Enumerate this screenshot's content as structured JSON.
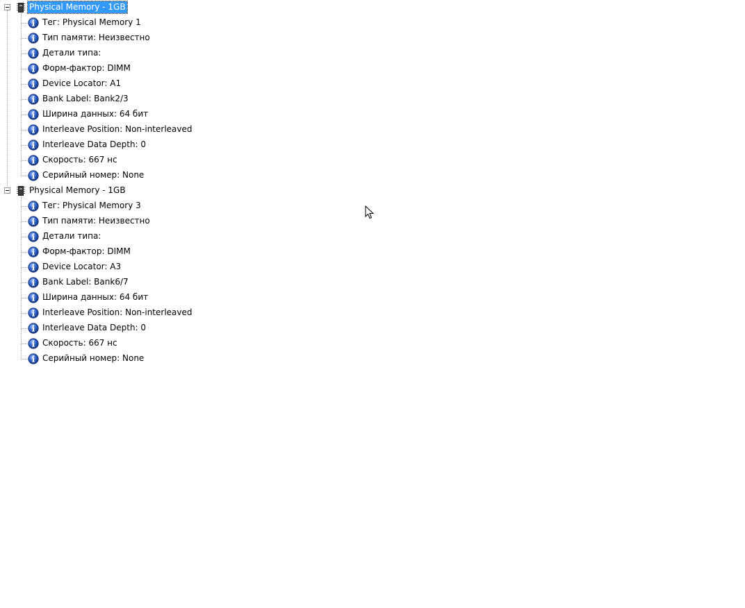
{
  "tree": {
    "nodes": [
      {
        "label": "Physical Memory - 1GB",
        "selected": true,
        "icon": "memory-chip-icon",
        "children": [
          "Тег: Physical Memory 1",
          "Тип памяти: Неизвестно",
          "Детали типа:",
          "Форм-фактор: DIMM",
          "Device Locator: A1",
          "Bank Label: Bank2/3",
          "Ширина данных: 64 бит",
          "Interleave Position: Non-interleaved",
          "Interleave Data Depth: 0",
          "Скорость: 667 нс",
          "Серийный номер: None"
        ]
      },
      {
        "label": "Physical Memory - 1GB",
        "selected": false,
        "icon": "memory-chip-icon",
        "children": [
          "Тег: Physical Memory 3",
          "Тип памяти: Неизвестно",
          "Детали типа:",
          "Форм-фактор: DIMM",
          "Device Locator: A3",
          "Bank Label: Bank6/7",
          "Ширина данных: 64 бит",
          "Interleave Position: Non-interleaved",
          "Interleave Data Depth: 0",
          "Скорость: 667 нс",
          "Серийный номер: None"
        ]
      }
    ],
    "leaf_icon": "info-icon"
  },
  "colors": {
    "selection_bg": "#3399ff",
    "info_icon_blue": "#1f4fa3"
  }
}
